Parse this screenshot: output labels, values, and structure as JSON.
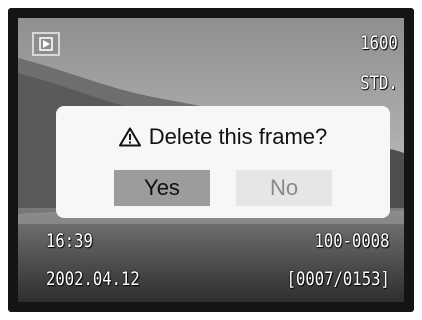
{
  "osd": {
    "resolution": "1600",
    "quality": "STD.",
    "time": "16:39",
    "file_number": "100-0008",
    "date": "2002.04.12",
    "frame_counter": "[0007/0153]",
    "mode_icon": "playback-icon"
  },
  "dialog": {
    "icon": "warning-triangle-icon",
    "message": "Delete this frame?",
    "yes_label": "Yes",
    "no_label": "No",
    "selected": "Yes"
  },
  "colors": {
    "selected_button": "#9c9c9c",
    "unselected_button": "#e6e6e6",
    "dialog_background": "#f7f7f7"
  }
}
